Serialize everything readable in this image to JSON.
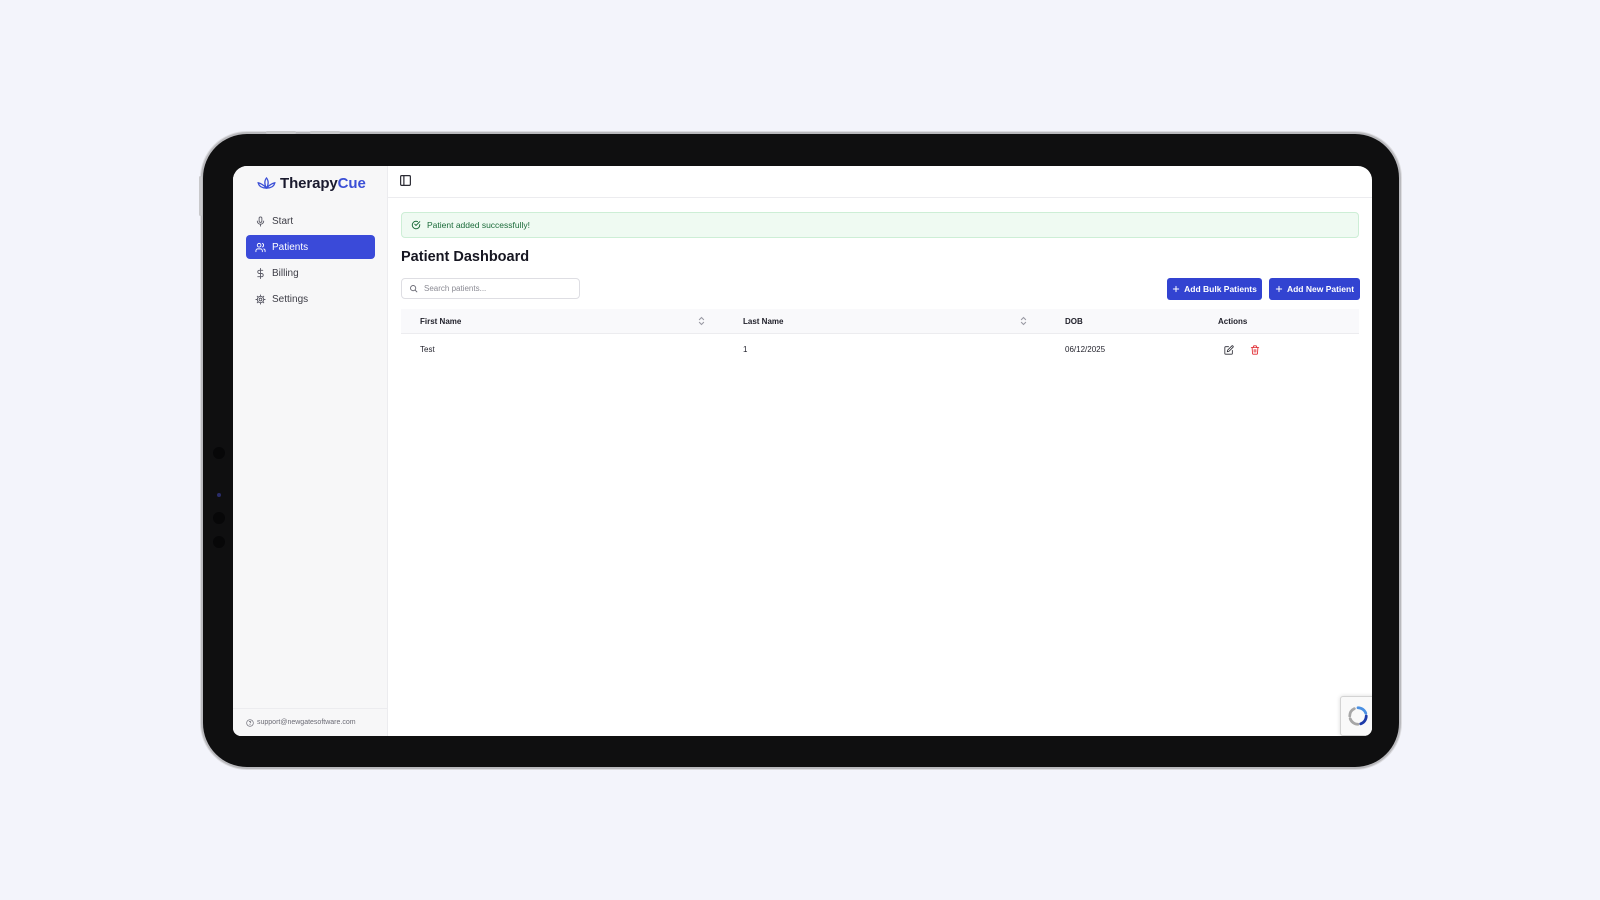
{
  "app": {
    "logo_primary": "Therapy",
    "logo_accent": "Cue",
    "accent_color": "#3a4ad9"
  },
  "sidebar": {
    "items": [
      {
        "label": "Start",
        "icon": "microphone-icon"
      },
      {
        "label": "Patients",
        "icon": "users-icon",
        "active": true
      },
      {
        "label": "Billing",
        "icon": "dollar-icon"
      },
      {
        "label": "Settings",
        "icon": "gear-icon"
      }
    ],
    "support_email": "support@newgatesoftware.com"
  },
  "toast": {
    "message": "Patient added successfully!",
    "color": "#1b6b3a"
  },
  "page": {
    "title": "Patient Dashboard"
  },
  "search": {
    "placeholder": "Search patients..."
  },
  "buttons": {
    "add_bulk": "Add Bulk Patients",
    "add_new": "Add New Patient"
  },
  "table": {
    "headers": {
      "first_name": "First Name",
      "last_name": "Last Name",
      "dob": "DOB",
      "actions": "Actions"
    },
    "rows": [
      {
        "first_name": "Test",
        "last_name": "1",
        "dob": "06/12/2025"
      }
    ]
  }
}
